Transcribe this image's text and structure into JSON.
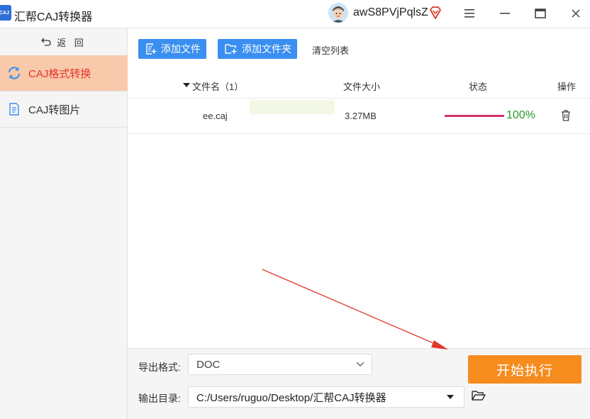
{
  "app": {
    "logo_text": "CAJ",
    "title": "汇帮CAJ转换器",
    "username": "awS8PVjPqlsZ"
  },
  "sidebar": {
    "back_label": "返 回",
    "items": [
      {
        "label": "CAJ格式转换",
        "active": true,
        "icon": "refresh-icon"
      },
      {
        "label": "CAJ转图片",
        "active": false,
        "icon": "document-icon"
      }
    ]
  },
  "toolbar": {
    "add_file_label": "添加文件",
    "add_folder_label": "添加文件夹",
    "clear_label": "清空列表"
  },
  "table": {
    "headers": {
      "name": "文件名（1）",
      "size": "文件大小",
      "status": "状态",
      "action": "操作"
    },
    "rows": [
      {
        "name": "ee.caj",
        "size": "3.27MB",
        "progress": 100,
        "progress_text": "100%"
      }
    ]
  },
  "bottom": {
    "format_label": "导出格式:",
    "format_value": "DOC",
    "output_label": "输出目录:",
    "output_value": "C:/Users/ruguo/Desktop/汇帮CAJ转换器",
    "start_label": "开始执行"
  },
  "colors": {
    "accent_blue": "#3a8ff0",
    "start_orange": "#f68b1e",
    "active_nav": "#f8c9aa",
    "active_text": "#e8322c",
    "progress": "#d6336c",
    "percent_green": "#2a9a2a",
    "annotation_arrow": "#e0362b"
  }
}
